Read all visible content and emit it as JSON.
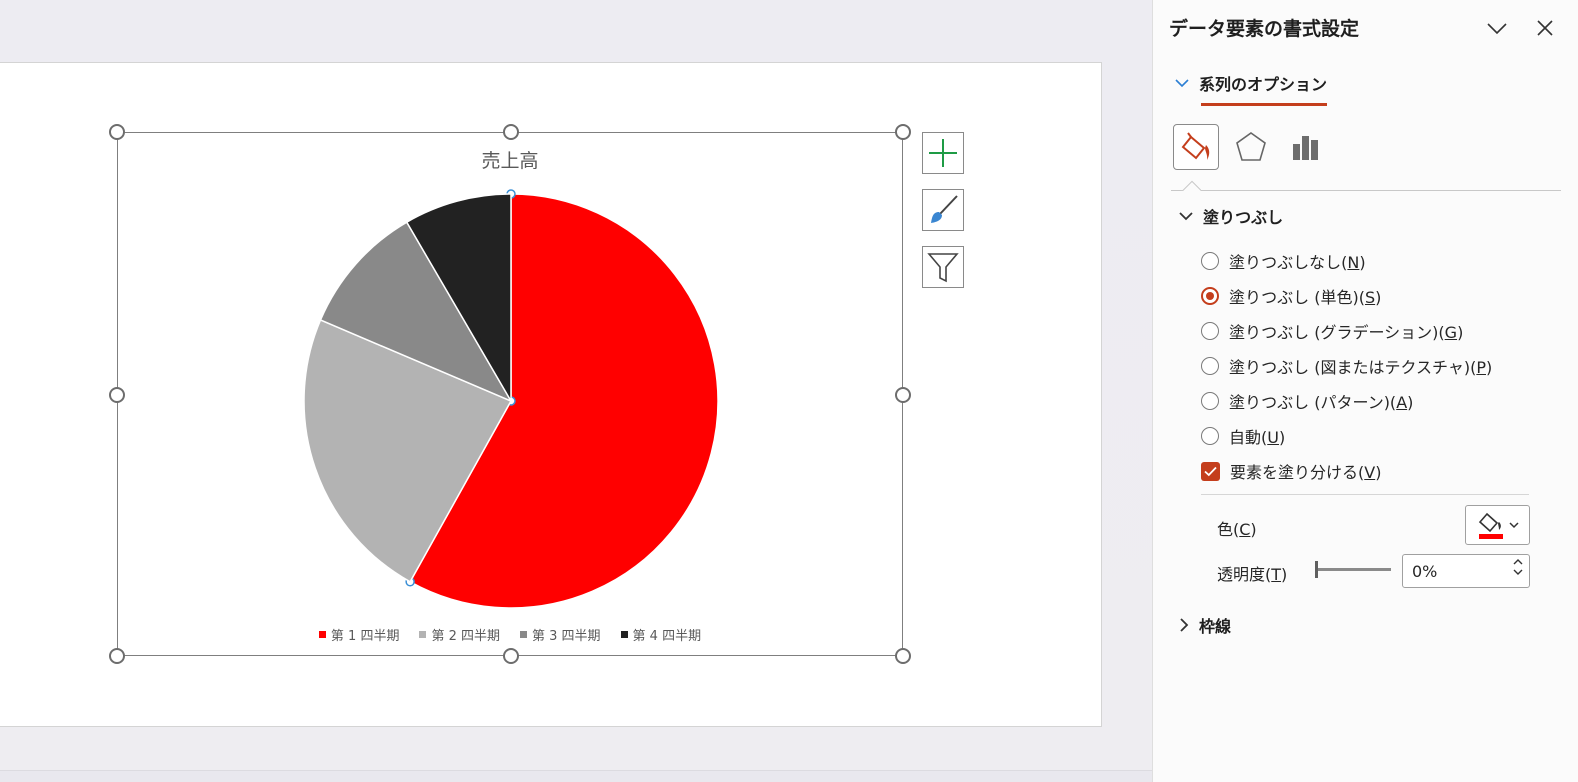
{
  "chart": {
    "title": "売上高",
    "legend": [
      "第 1 四半期",
      "第 2 四半期",
      "第 3 四半期",
      "第 4 四半期"
    ]
  },
  "chart_data": {
    "type": "pie",
    "title": "売上高",
    "categories": [
      "第 1 四半期",
      "第 2 四半期",
      "第 3 四半期",
      "第 4 四半期"
    ],
    "values": [
      58.1,
      23.3,
      10.2,
      8.4
    ],
    "colors": [
      "#ff0000",
      "#b3b3b3",
      "#898989",
      "#222222"
    ],
    "legend_position": "bottom",
    "selected_point": "第 1 四半期"
  },
  "chart_tools": {
    "elements_icon": "plus-icon",
    "styles_icon": "brush-icon",
    "filter_icon": "funnel-icon"
  },
  "pane": {
    "title": "データ要素の書式設定",
    "tab": "系列のオプション",
    "icon_tabs": [
      "fill-line-icon",
      "effects-icon",
      "series-options-icon"
    ],
    "fill_section": "塗りつぶし",
    "fill_options": [
      {
        "prefix": "塗りつぶしなし(",
        "key": "N",
        "suffix": ")",
        "checked": false
      },
      {
        "prefix": "塗りつぶし (単色)(",
        "key": "S",
        "suffix": ")",
        "checked": true
      },
      {
        "prefix": "塗りつぶし (グラデーション)(",
        "key": "G",
        "suffix": ")",
        "checked": false
      },
      {
        "prefix": "塗りつぶし (図またはテクスチャ)(",
        "key": "P",
        "suffix": ")",
        "checked": false
      },
      {
        "prefix": "塗りつぶし (パターン)(",
        "key": "A",
        "suffix": ")",
        "checked": false
      },
      {
        "prefix": "自動(",
        "key": "U",
        "suffix": ")",
        "checked": false
      }
    ],
    "vary_colors": {
      "prefix": "要素を塗り分ける(",
      "key": "V",
      "suffix": ")",
      "checked": true
    },
    "color_label": {
      "prefix": "色(",
      "key": "C",
      "suffix": ")"
    },
    "fill_color": "#ff0000",
    "transparency_label": {
      "prefix": "透明度(",
      "key": "T",
      "suffix": ")"
    },
    "transparency_value": "0%",
    "transparency_level": 0,
    "border_section": "枠線",
    "accent": "#c43e1c"
  }
}
